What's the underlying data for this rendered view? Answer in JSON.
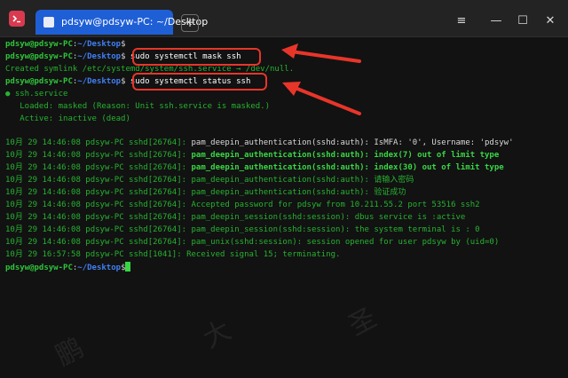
{
  "window": {
    "tab_title": "pdsyw@pdsyw-PC: ~/Desktop",
    "add_tab_label": "+",
    "controls": {
      "menu": "≡",
      "minimize": "—",
      "maximize": "☐",
      "close": "✕"
    }
  },
  "prompt": {
    "user": "pdsyw@pdsyw-PC",
    "sep": ":",
    "path": "~/Desktop",
    "symbol": "$"
  },
  "commands": {
    "cmd1": "",
    "cmd2": "sudo systemctl mask ssh",
    "cmd3": "sudo systemctl status ssh"
  },
  "output": {
    "symlink": "Created symlink /etc/systemd/system/ssh.service → /dev/null.",
    "service_name": "● ssh.service",
    "loaded": "   Loaded: masked (Reason: Unit ssh.service is masked.)",
    "active": "   Active: inactive (dead)"
  },
  "log": {
    "prefix_a": "10月 29 14:46:08 pdsyw-PC sshd[26764]: ",
    "l1_msg": "pam_deepin_authentication(sshd:auth): IsMFA: '0', Username: 'pdsyw'",
    "l2_msg": "pam_deepin_authentication(sshd:auth): index(7) out of limit type",
    "l3_msg": "pam_deepin_authentication(sshd:auth): index(30) out of limit type",
    "l4_msg": "pam_deepin_authentication(sshd:auth): 请输入密码",
    "l5_msg": "pam_deepin_authentication(sshd:auth): 验证成功",
    "l6_msg": "Accepted password for pdsyw from 10.211.55.2 port 53516 ssh2",
    "l7_msg": "pam_deepin_session(sshd:session): dbus service is :active",
    "l8_msg": "pam_deepin_session(sshd:session): the system terminal is : 0",
    "l9_msg": "pam_unix(sshd:session): session opened for user pdsyw by (uid=0)",
    "l10": "10月 29 16:57:58 pdsyw-PC sshd[1041]: Received signal 15; terminating."
  },
  "watermark": [
    "鹏",
    "大",
    "圣"
  ],
  "colors": {
    "annotation": "#e8352a",
    "prompt_user": "#2fc43a",
    "prompt_path": "#3f7ff2",
    "output": "#26b230",
    "tab_active": "#1f5fd6"
  }
}
